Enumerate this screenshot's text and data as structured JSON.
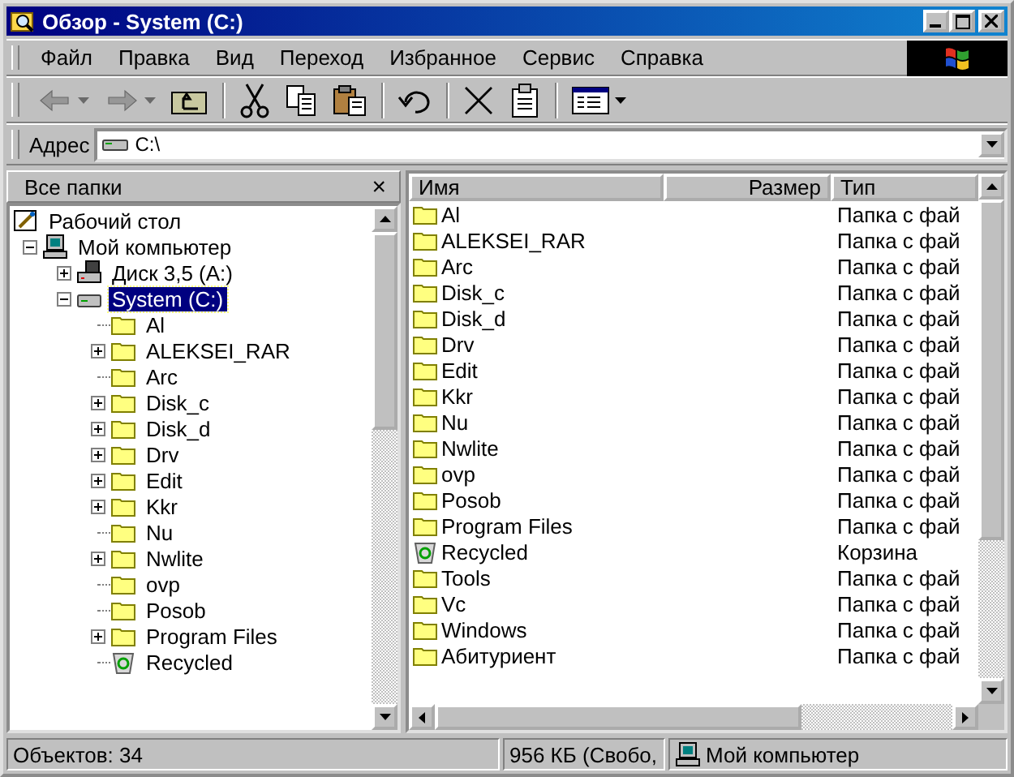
{
  "window": {
    "title": "Обзор - System (C:)"
  },
  "menu": [
    "Файл",
    "Правка",
    "Вид",
    "Переход",
    "Избранное",
    "Сервис",
    "Справка"
  ],
  "toolbar": [
    {
      "kind": "back",
      "disabled": true,
      "dropdown": true
    },
    {
      "kind": "forward",
      "disabled": true,
      "dropdown": true
    },
    {
      "kind": "up",
      "disabled": false,
      "dropdown": false
    },
    {
      "kind": "sep"
    },
    {
      "kind": "cut",
      "disabled": false,
      "dropdown": false
    },
    {
      "kind": "copy",
      "disabled": false,
      "dropdown": false
    },
    {
      "kind": "paste",
      "disabled": false,
      "dropdown": false
    },
    {
      "kind": "sep"
    },
    {
      "kind": "undo",
      "disabled": false,
      "dropdown": false
    },
    {
      "kind": "sep"
    },
    {
      "kind": "delete",
      "disabled": false,
      "dropdown": false
    },
    {
      "kind": "properties",
      "disabled": false,
      "dropdown": false
    },
    {
      "kind": "sep"
    },
    {
      "kind": "views",
      "disabled": false,
      "dropdown": true
    }
  ],
  "address": {
    "label": "Адрес",
    "value": "C:\\"
  },
  "folders_pane": {
    "title": "Все папки",
    "close": "×",
    "tree": [
      {
        "label": "Рабочий стол",
        "kind": "desktop",
        "selected": false,
        "children": [
          {
            "label": "Мой компьютер",
            "kind": "computer",
            "selected": false,
            "expanded": true,
            "children": [
              {
                "label": "Диск 3,5 (A:)",
                "kind": "floppy",
                "selected": false,
                "expanded": false
              },
              {
                "label": "System (C:)",
                "kind": "hdd",
                "selected": true,
                "expanded": true,
                "children": [
                  {
                    "label": "Al",
                    "kind": "folder",
                    "selected": false
                  },
                  {
                    "label": "ALEKSEI_RAR",
                    "kind": "folder",
                    "selected": false,
                    "expanded": false
                  },
                  {
                    "label": "Arc",
                    "kind": "folder",
                    "selected": false
                  },
                  {
                    "label": "Disk_c",
                    "kind": "folder",
                    "selected": false,
                    "expanded": false
                  },
                  {
                    "label": "Disk_d",
                    "kind": "folder",
                    "selected": false,
                    "expanded": false
                  },
                  {
                    "label": "Drv",
                    "kind": "folder",
                    "selected": false,
                    "expanded": false
                  },
                  {
                    "label": "Edit",
                    "kind": "folder",
                    "selected": false,
                    "expanded": false
                  },
                  {
                    "label": "Kkr",
                    "kind": "folder",
                    "selected": false,
                    "expanded": false
                  },
                  {
                    "label": "Nu",
                    "kind": "folder",
                    "selected": false
                  },
                  {
                    "label": "Nwlite",
                    "kind": "folder",
                    "selected": false,
                    "expanded": false
                  },
                  {
                    "label": "ovp",
                    "kind": "folder",
                    "selected": false
                  },
                  {
                    "label": "Posob",
                    "kind": "folder",
                    "selected": false
                  },
                  {
                    "label": "Program Files",
                    "kind": "folder",
                    "selected": false,
                    "expanded": false
                  },
                  {
                    "label": "Recycled",
                    "kind": "recycle",
                    "selected": false
                  }
                ]
              }
            ]
          }
        ]
      }
    ]
  },
  "file_list": {
    "columns": [
      "Имя",
      "Размер",
      "Тип"
    ],
    "rows": [
      {
        "name": "Al",
        "type": "Папка с фай",
        "kind": "folder"
      },
      {
        "name": "ALEKSEI_RAR",
        "type": "Папка с фай",
        "kind": "folder"
      },
      {
        "name": "Arc",
        "type": "Папка с фай",
        "kind": "folder"
      },
      {
        "name": "Disk_c",
        "type": "Папка с фай",
        "kind": "folder"
      },
      {
        "name": "Disk_d",
        "type": "Папка с фай",
        "kind": "folder"
      },
      {
        "name": "Drv",
        "type": "Папка с фай",
        "kind": "folder"
      },
      {
        "name": "Edit",
        "type": "Папка с фай",
        "kind": "folder"
      },
      {
        "name": "Kkr",
        "type": "Папка с фай",
        "kind": "folder"
      },
      {
        "name": "Nu",
        "type": "Папка с фай",
        "kind": "folder"
      },
      {
        "name": "Nwlite",
        "type": "Папка с фай",
        "kind": "folder"
      },
      {
        "name": "ovp",
        "type": "Папка с фай",
        "kind": "folder"
      },
      {
        "name": "Posob",
        "type": "Папка с фай",
        "kind": "folder"
      },
      {
        "name": "Program Files",
        "type": "Папка с фай",
        "kind": "folder"
      },
      {
        "name": "Recycled",
        "type": "Корзина",
        "kind": "recycle"
      },
      {
        "name": "Tools",
        "type": "Папка с фай",
        "kind": "folder"
      },
      {
        "name": "Vc",
        "type": "Папка с фай",
        "kind": "folder"
      },
      {
        "name": "Windows",
        "type": "Папка с фай",
        "kind": "folder"
      },
      {
        "name": "Абитуриент",
        "type": "Папка с фай",
        "kind": "folder"
      }
    ]
  },
  "status_bar": {
    "objects": "Объектов: 34",
    "free": "956 КБ (Свобо,",
    "location": "Мой компьютер"
  }
}
